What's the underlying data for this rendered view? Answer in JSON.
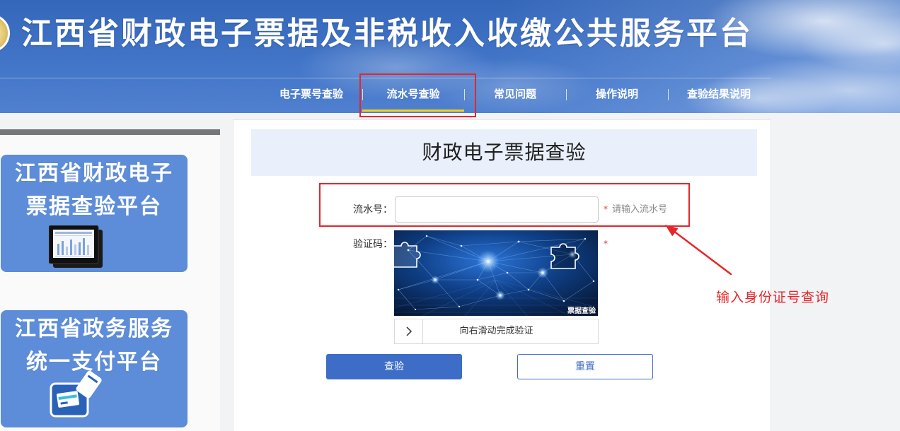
{
  "header": {
    "title": "江西省财政电子票据及非税收入收缴公共服务平台",
    "logo_icon": "emblem-icon",
    "nav": [
      {
        "label": "电子票号查验",
        "active": false
      },
      {
        "label": "流水号查验",
        "active": true
      },
      {
        "label": "常见问题",
        "active": false
      },
      {
        "label": "操作说明",
        "active": false
      },
      {
        "label": "查验结果说明",
        "active": false
      }
    ]
  },
  "sidebar": {
    "cards": [
      {
        "line1": "江西省财政电子",
        "line2": "票据查验平台",
        "icon": "monitor-icon"
      },
      {
        "line1": "江西省政务服务",
        "line2": "统一支付平台",
        "icon": "payment-card-icon"
      }
    ]
  },
  "main": {
    "title": "财政电子票据查验",
    "serial": {
      "label": "流水号：",
      "value": "",
      "required_mark": "*",
      "hint": "请输入流水号"
    },
    "captcha": {
      "label": "验证码：",
      "required_mark": "*",
      "watermark": "票据查验",
      "icon": "puzzle-captcha-icon"
    },
    "slider": {
      "text": "向右滑动完成验证",
      "handle_icon": "chevron-right-icon"
    },
    "buttons": {
      "submit": "查验",
      "reset": "重置"
    }
  },
  "annotations": {
    "note": "输入身份证号查询",
    "color": "#e5262a"
  },
  "colors": {
    "header_blue": "#3466b9",
    "accent_blue": "#3d6dc7",
    "card_blue": "#5d8cd8",
    "active_underline": "#f2d21b",
    "required_red": "#e53935",
    "title_band": "#e9f0fb"
  }
}
